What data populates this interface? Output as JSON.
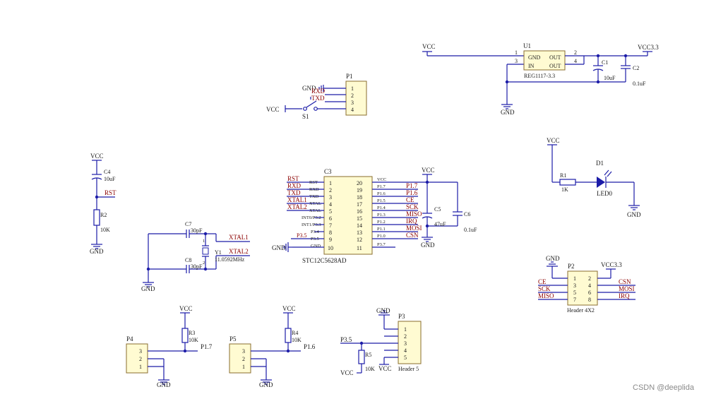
{
  "watermark": "CSDN @deeplida",
  "regulator": {
    "ref": "U1",
    "part": "REG1117-3.3",
    "pins": [
      "1",
      "3",
      "2",
      "4"
    ],
    "pin_labels": [
      "GND",
      "IN",
      "OUT",
      "OUT"
    ],
    "vcc_in": "VCC",
    "vcc_out": "VCC3.3",
    "gnd": "GND",
    "c1_ref": "C1",
    "c1_val": "10uF",
    "c2_ref": "C2",
    "c2_val": "0.1uF"
  },
  "p1": {
    "ref": "P1",
    "pins": [
      "1",
      "2",
      "3",
      "4"
    ],
    "gnd": "GND",
    "rxd": "RXD",
    "txd": "TXD",
    "vcc": "VCC",
    "switch": "S1"
  },
  "mcu": {
    "ref": "C3",
    "part": "STC12C5628AD",
    "left_nums": [
      "1",
      "2",
      "3",
      "4",
      "5",
      "6",
      "7",
      "8",
      "9",
      "10"
    ],
    "left_pins": [
      "RST",
      "RXD",
      "TXD",
      "XTAL",
      "XTAL",
      "INT0/P3.2",
      "INT1/P3.3",
      "P3.4",
      "P3.5",
      "GND"
    ],
    "left_nets": [
      "RST",
      "RXD",
      "TXD",
      "XTAL1",
      "XTAL2",
      "",
      "",
      "",
      "P3.5",
      ""
    ],
    "gnd_net": "GND",
    "right_nums": [
      "20",
      "19",
      "18",
      "17",
      "16",
      "15",
      "14",
      "13",
      "12",
      "11"
    ],
    "right_pins": [
      "VCC",
      "P1.7",
      "P1.6",
      "P1.5",
      "P1.4",
      "P1.3",
      "P1.2",
      "P1.1",
      "P1.0",
      "P3.7"
    ],
    "right_nets": [
      "",
      "P1.7",
      "P1.6",
      "CE",
      "SCK",
      "MISO",
      "IRQ",
      "MOSI",
      "CSN",
      ""
    ],
    "vcc": "VCC",
    "gnd": "GND",
    "c5_ref": "C5",
    "c5_val": "47uF",
    "c6_ref": "C6",
    "c6_val": "0.1uF"
  },
  "reset": {
    "vcc": "VCC",
    "c4_ref": "C4",
    "c4_val": "10uF",
    "net": "RST",
    "r2_ref": "R2",
    "r2_val": "10K",
    "gnd": "GND"
  },
  "crystal": {
    "c7_ref": "C7",
    "c7_val": "30pF",
    "c8_ref": "C8",
    "c8_val": "30pF",
    "y_ref": "Y1",
    "y_val": "11.0592MHz",
    "pin1": "1",
    "pin2": "2",
    "xtal1": "XTAL1",
    "xtal2": "XTAL2",
    "gnd": "GND"
  },
  "led": {
    "vcc": "VCC",
    "r1_ref": "R1",
    "r1_val": "1K",
    "d_ref": "D1",
    "d_val": "LED0",
    "gnd": "GND"
  },
  "p2": {
    "ref": "P2",
    "part": "Header 4X2",
    "gnd": "GND",
    "vcc": "VCC3.3",
    "left_nums": [
      "1",
      "3",
      "5",
      "7"
    ],
    "right_nums": [
      "2",
      "4",
      "6",
      "8"
    ],
    "left_nets": [
      "",
      "CE",
      "SCK",
      "MISO"
    ],
    "right_nets": [
      "",
      "CSN",
      "MOSI",
      "IRQ"
    ]
  },
  "p4": {
    "ref": "P4",
    "pins": [
      "3",
      "2",
      "1"
    ],
    "vcc": "VCC",
    "r_ref": "R3",
    "r_val": "10K",
    "net": "P1.7",
    "gnd": "GND"
  },
  "p5": {
    "ref": "P5",
    "pins": [
      "3",
      "2",
      "1"
    ],
    "vcc": "VCC",
    "r_ref": "R4",
    "r_val": "10K",
    "net": "P1.6",
    "gnd": "GND"
  },
  "p3": {
    "ref": "P3",
    "part": "Header 5",
    "pins": [
      "1",
      "2",
      "3",
      "4",
      "5"
    ],
    "gnd": "GND",
    "net": "P3.5",
    "r_ref": "R5",
    "r_val": "10K",
    "vcc_a": "VCC",
    "vcc_b": "VCC"
  }
}
